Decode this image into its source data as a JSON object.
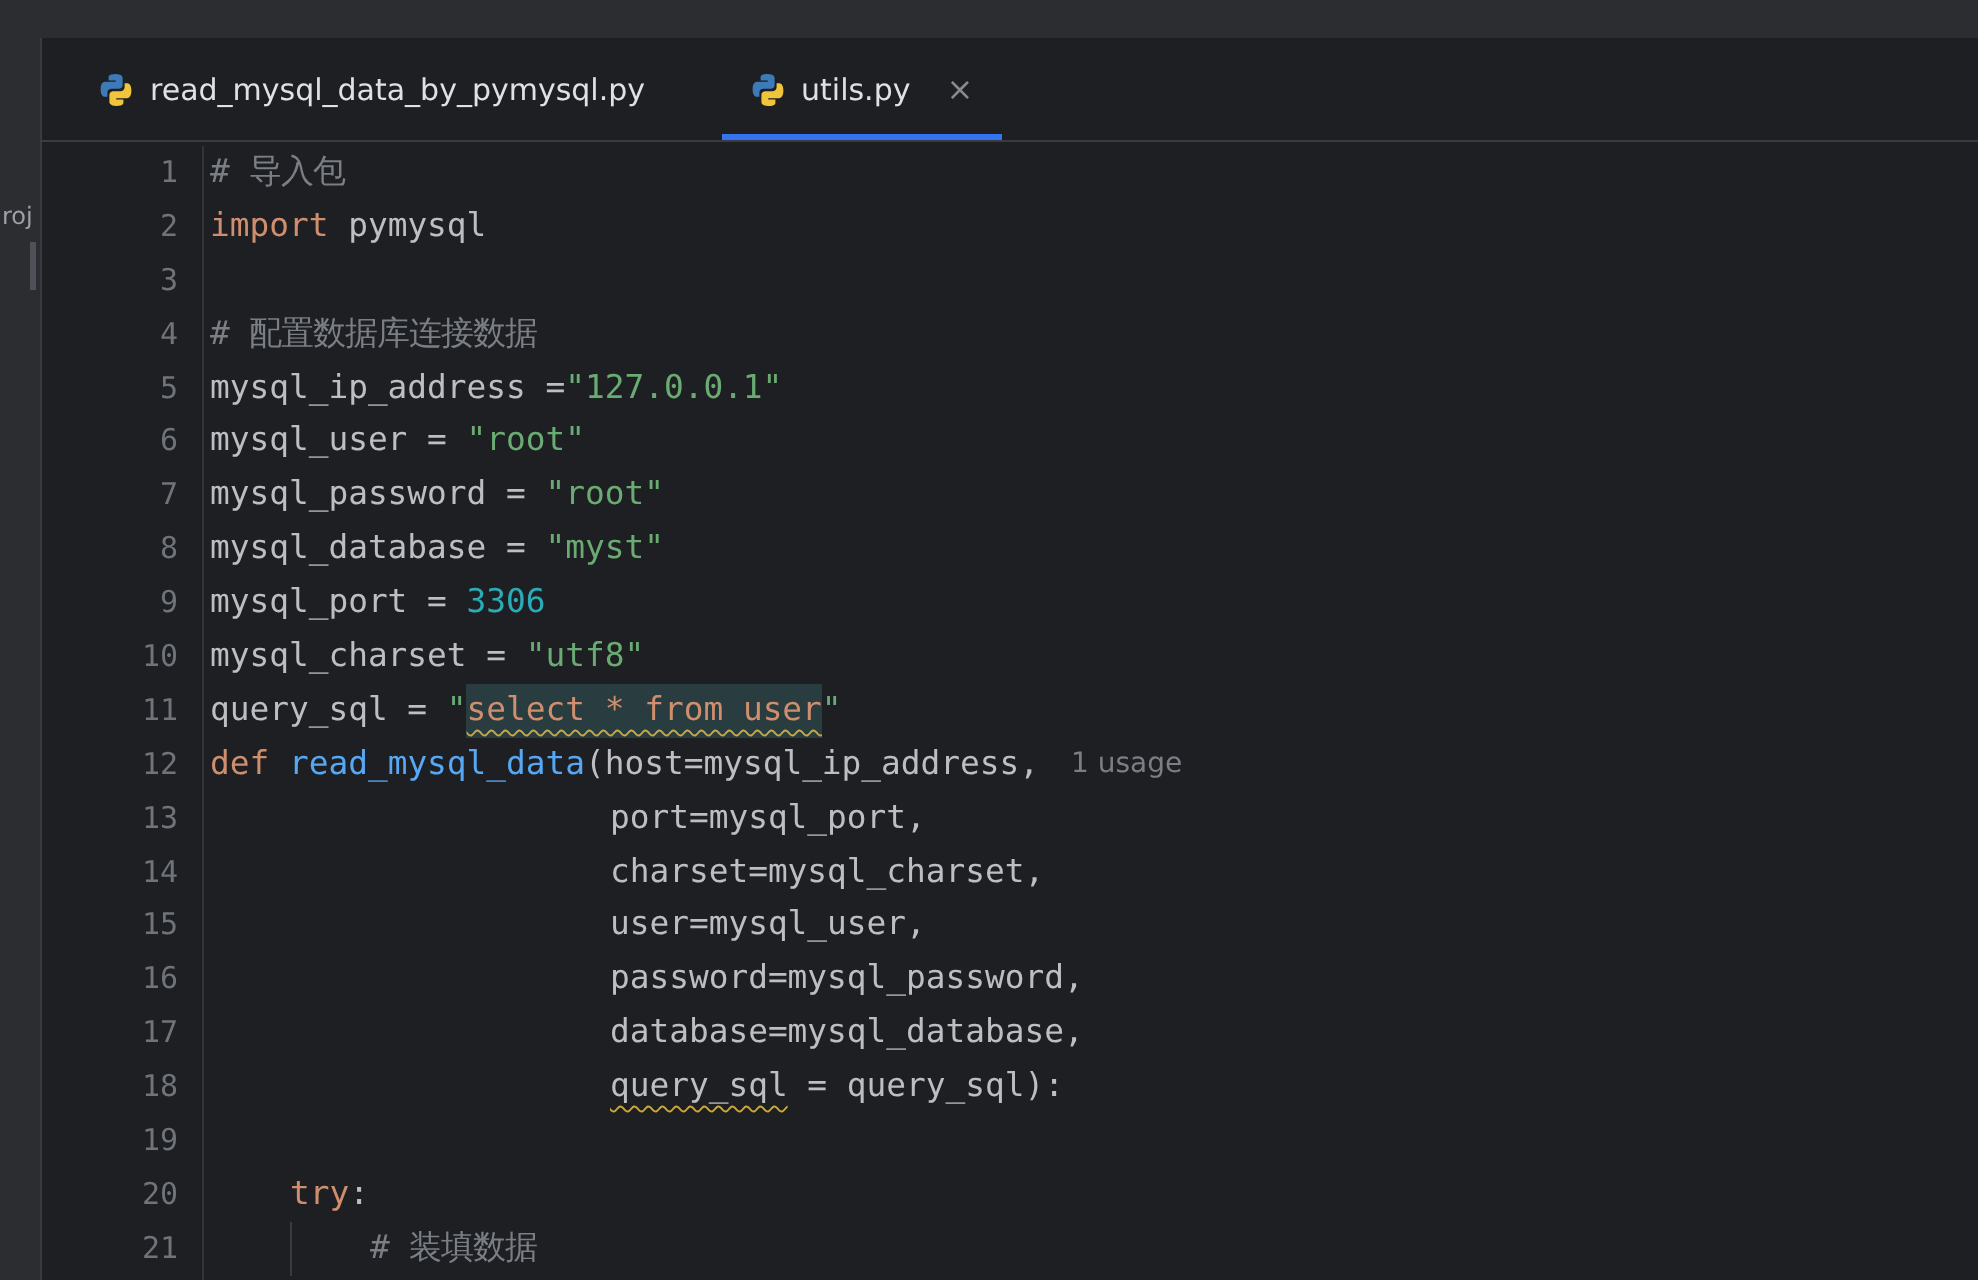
{
  "side_panel": {
    "label": "roj"
  },
  "tabs": [
    {
      "label": "read_mysql_data_by_pymysql.py",
      "selected": false
    },
    {
      "label": "utils.py",
      "selected": true,
      "close": "×"
    }
  ],
  "editor": {
    "lines": [
      {
        "number": "1",
        "kind": "top",
        "tokens": [
          {
            "kind": "comment",
            "text": "# 导入包"
          }
        ]
      },
      {
        "number": "2",
        "kind": "top",
        "tokens": [
          {
            "kind": "keyword",
            "text": "import"
          },
          {
            "kind": "plain",
            "text": " pymysql"
          }
        ]
      },
      {
        "number": "3",
        "kind": "top"
      },
      {
        "number": "4",
        "kind": "top",
        "tokens": [
          {
            "kind": "comment",
            "text": "# 配置数据库连接数据"
          }
        ]
      },
      {
        "number": "5",
        "kind": "top",
        "tokens": [
          {
            "kind": "plain",
            "text": "mysql_ip_address ="
          },
          {
            "kind": "string",
            "text": "\"127.0.0.1\""
          }
        ]
      },
      {
        "number": "6",
        "kind": "top",
        "tokens": [
          {
            "kind": "plain",
            "text": "mysql_user = "
          },
          {
            "kind": "string",
            "text": "\"root\""
          }
        ]
      },
      {
        "number": "7",
        "kind": "top",
        "tokens": [
          {
            "kind": "plain",
            "text": "mysql_password = "
          },
          {
            "kind": "string",
            "text": "\"root\""
          }
        ]
      },
      {
        "number": "8",
        "kind": "top",
        "tokens": [
          {
            "kind": "plain",
            "text": "mysql_database = "
          },
          {
            "kind": "string",
            "text": "\"myst\""
          }
        ]
      },
      {
        "number": "9",
        "kind": "top",
        "tokens": [
          {
            "kind": "plain",
            "text": "mysql_port = "
          },
          {
            "kind": "number",
            "text": "3306"
          }
        ]
      },
      {
        "number": "10",
        "kind": "top",
        "tokens": [
          {
            "kind": "plain",
            "text": "mysql_charset = "
          },
          {
            "kind": "string",
            "text": "\"utf8\""
          }
        ]
      },
      {
        "number": "11",
        "kind": "top",
        "tokens": [
          {
            "kind": "plain",
            "text": "query_sql = "
          },
          {
            "kind": "string",
            "text": "\""
          },
          {
            "kind": "sql",
            "text": "select * from user"
          },
          {
            "kind": "string",
            "text": "\""
          }
        ]
      },
      {
        "number": "12",
        "kind": "top",
        "tokens": [
          {
            "kind": "keyword",
            "text": "def "
          },
          {
            "kind": "function",
            "text": "read_mysql_data"
          },
          {
            "kind": "plain",
            "text": "(host=mysql_ip_address,"
          },
          {
            "kind": "hint",
            "text": "1 usage"
          }
        ]
      },
      {
        "number": "13",
        "kind": "continuation",
        "tokens": [
          {
            "kind": "plain",
            "text": "port=mysql_port,"
          }
        ]
      },
      {
        "number": "14",
        "kind": "continuation",
        "tokens": [
          {
            "kind": "plain",
            "text": "charset=mysql_charset,"
          }
        ]
      },
      {
        "number": "15",
        "kind": "continuation",
        "tokens": [
          {
            "kind": "plain",
            "text": "user=mysql_user,"
          }
        ]
      },
      {
        "number": "16",
        "kind": "continuation",
        "tokens": [
          {
            "kind": "plain",
            "text": "password=mysql_password,"
          }
        ]
      },
      {
        "number": "17",
        "kind": "continuation",
        "tokens": [
          {
            "kind": "plain",
            "text": "database=mysql_database,"
          }
        ]
      },
      {
        "number": "18",
        "kind": "continuation",
        "tokens": [
          {
            "kind": "warning",
            "text": "query_sql"
          },
          {
            "kind": "plain",
            "text": " = query_sql):"
          }
        ]
      },
      {
        "number": "19",
        "kind": "top"
      },
      {
        "number": "20",
        "kind": "block",
        "tokens": [
          {
            "kind": "keyword",
            "text": "try"
          },
          {
            "kind": "plain",
            "text": ":"
          }
        ]
      },
      {
        "number": "21",
        "kind": "nested",
        "tokens": [
          {
            "kind": "comment",
            "text": "# 装填数据"
          }
        ]
      }
    ]
  }
}
